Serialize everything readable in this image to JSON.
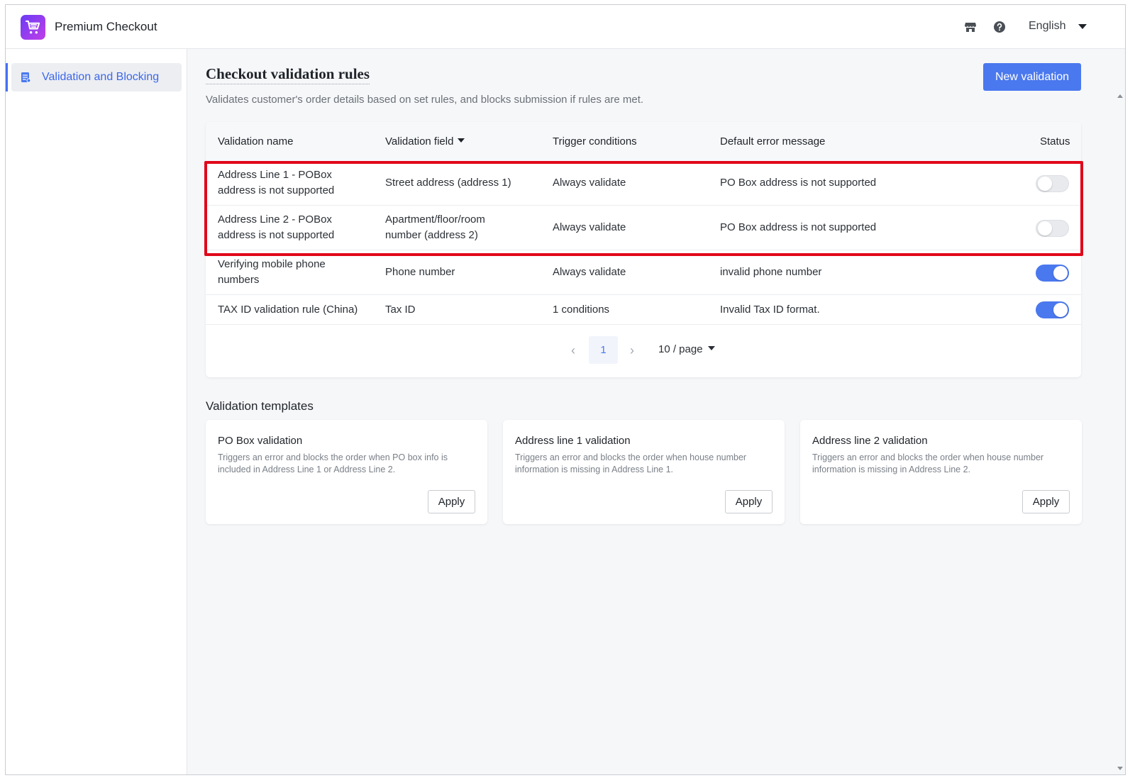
{
  "header": {
    "app_title": "Premium Checkout",
    "language": "English",
    "icons": [
      "store-icon",
      "help-icon"
    ]
  },
  "sidebar": {
    "items": [
      {
        "label": "Validation and Blocking",
        "icon": "document-icon",
        "active": true
      }
    ]
  },
  "main": {
    "title": "Checkout validation rules",
    "description": "Validates customer's order details based on set rules, and blocks submission if rules are met.",
    "new_button_label": "New validation",
    "table": {
      "columns": [
        "Validation name",
        "Validation field",
        "Trigger conditions",
        "Default error message",
        "Status"
      ],
      "rows": [
        {
          "name": "Address Line 1 - POBox address is not supported",
          "field": "Street address (address 1)",
          "trigger": "Always validate",
          "message": "PO Box address is not supported",
          "enabled": false
        },
        {
          "name": "Address Line 2 - POBox address is not supported",
          "field": "Apartment/floor/room number (address 2)",
          "trigger": "Always validate",
          "message": "PO Box address is not supported",
          "enabled": false
        },
        {
          "name": "Verifying mobile phone numbers",
          "field": "Phone number",
          "trigger": "Always validate",
          "message": "invalid phone number",
          "enabled": true
        },
        {
          "name": "TAX ID validation rule (China)",
          "field": "Tax ID",
          "trigger": "1 conditions",
          "message": "Invalid Tax ID format.",
          "enabled": true
        }
      ]
    },
    "pagination": {
      "current_page": "1",
      "page_size": "10 / page",
      "prev_icon": "chevron-left-icon",
      "next_icon": "chevron-right-icon"
    },
    "templates_title": "Validation templates",
    "templates": [
      {
        "title": "PO Box validation",
        "description": "Triggers an error and blocks the order when PO box info is included in Address Line 1 or Address Line 2.",
        "button": "Apply"
      },
      {
        "title": "Address line 1 validation",
        "description": "Triggers an error and blocks the order when house number information is missing in Address Line 1.",
        "button": "Apply"
      },
      {
        "title": "Address line 2 validation",
        "description": "Triggers an error and blocks the order when house number information is missing in Address Line 2.",
        "button": "Apply"
      }
    ]
  },
  "colors": {
    "accent": "#4a78ee",
    "highlight_border": "#e0081a",
    "logo_gradient_start": "#6a3cf5",
    "logo_gradient_end": "#c03ee8"
  }
}
